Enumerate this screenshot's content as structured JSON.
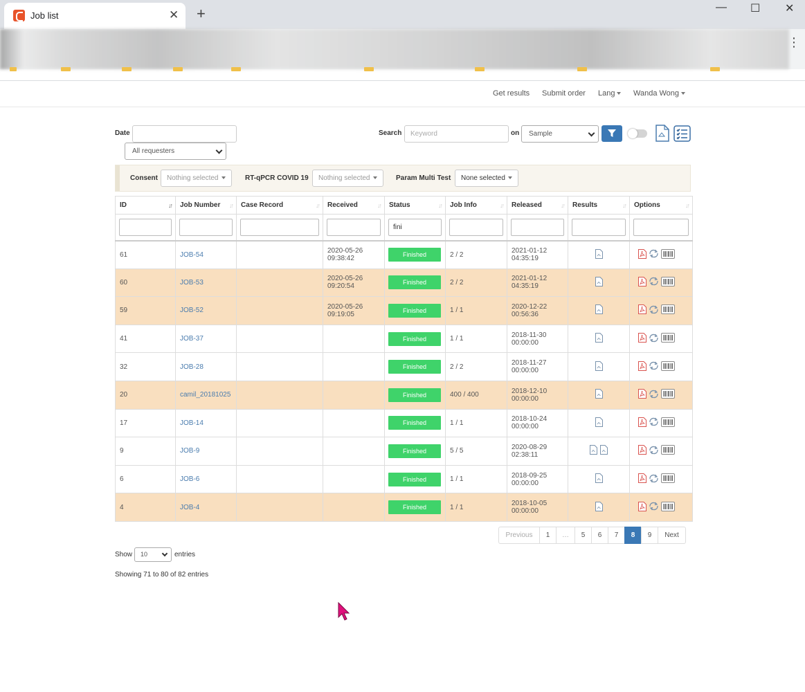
{
  "browser": {
    "tab_title": "Job list",
    "close_glyph": "✕",
    "new_tab_glyph": "+",
    "minimize_glyph": "—",
    "maximize_glyph": "☐",
    "window_close_glyph": "✕",
    "menu_glyph": "⋮"
  },
  "nav": {
    "get_results": "Get results",
    "submit_order": "Submit order",
    "lang": "Lang",
    "user": "Wanda Wong"
  },
  "filters": {
    "date_label": "Date",
    "requesters_value": "All requesters",
    "search_label": "Search",
    "search_placeholder": "Keyword",
    "on_label": "on",
    "on_value": "Sample"
  },
  "multiselects": {
    "consent_label": "Consent",
    "consent_value": "Nothing selected",
    "covid_label": "RT-qPCR COVID 19",
    "covid_value": "Nothing selected",
    "param_label": "Param Multi Test",
    "param_value": "None selected"
  },
  "table": {
    "headers": {
      "id": "ID",
      "job_number": "Job Number",
      "case_record": "Case Record",
      "received": "Received",
      "status": "Status",
      "job_info": "Job Info",
      "released": "Released",
      "results": "Results",
      "options": "Options"
    },
    "status_filter_value": "fini",
    "rows": [
      {
        "id": "61",
        "job": "JOB-54",
        "case": "",
        "received_date": "2020-05-26",
        "received_time": "09:38:42",
        "status": "Finished",
        "info": "2 / 2",
        "released_date": "2021-01-12",
        "released_time": "04:35:19",
        "results": 1,
        "highlight": false
      },
      {
        "id": "60",
        "job": "JOB-53",
        "case": "",
        "received_date": "2020-05-26",
        "received_time": "09:20:54",
        "status": "Finished",
        "info": "2 / 2",
        "released_date": "2021-01-12",
        "released_time": "04:35:19",
        "results": 1,
        "highlight": true
      },
      {
        "id": "59",
        "job": "JOB-52",
        "case": "",
        "received_date": "2020-05-26",
        "received_time": "09:19:05",
        "status": "Finished",
        "info": "1 / 1",
        "released_date": "2020-12-22",
        "released_time": "00:56:36",
        "results": 1,
        "highlight": true
      },
      {
        "id": "41",
        "job": "JOB-37",
        "case": "",
        "received_date": "",
        "received_time": "",
        "status": "Finished",
        "info": "1 / 1",
        "released_date": "2018-11-30",
        "released_time": "00:00:00",
        "results": 1,
        "highlight": false
      },
      {
        "id": "32",
        "job": "JOB-28",
        "case": "",
        "received_date": "",
        "received_time": "",
        "status": "Finished",
        "info": "2 / 2",
        "released_date": "2018-11-27",
        "released_time": "00:00:00",
        "results": 1,
        "highlight": false
      },
      {
        "id": "20",
        "job": "camil_20181025",
        "case": "",
        "received_date": "",
        "received_time": "",
        "status": "Finished",
        "info": "400 / 400",
        "released_date": "2018-12-10",
        "released_time": "00:00:00",
        "results": 1,
        "highlight": true
      },
      {
        "id": "17",
        "job": "JOB-14",
        "case": "",
        "received_date": "",
        "received_time": "",
        "status": "Finished",
        "info": "1 / 1",
        "released_date": "2018-10-24",
        "released_time": "00:00:00",
        "results": 1,
        "highlight": false
      },
      {
        "id": "9",
        "job": "JOB-9",
        "case": "",
        "received_date": "",
        "received_time": "",
        "status": "Finished",
        "info": "5 / 5",
        "released_date": "2020-08-29",
        "released_time": "02:38:11",
        "results": 2,
        "highlight": false
      },
      {
        "id": "6",
        "job": "JOB-6",
        "case": "",
        "received_date": "",
        "received_time": "",
        "status": "Finished",
        "info": "1 / 1",
        "released_date": "2018-09-25",
        "released_time": "00:00:00",
        "results": 1,
        "highlight": false
      },
      {
        "id": "4",
        "job": "JOB-4",
        "case": "",
        "received_date": "",
        "received_time": "",
        "status": "Finished",
        "info": "1 / 1",
        "released_date": "2018-10-05",
        "released_time": "00:00:00",
        "results": 1,
        "highlight": true
      }
    ]
  },
  "pagination": {
    "previous": "Previous",
    "pages": [
      "1",
      "…",
      "5",
      "6",
      "7",
      "8",
      "9"
    ],
    "active": "8",
    "next": "Next"
  },
  "footer": {
    "show_label": "Show",
    "length_value": "10",
    "entries_label": "entries",
    "info": "Showing 71 to 80 of 82 entries"
  },
  "colors": {
    "accent": "#3a78b5",
    "status_finished": "#3fd36a",
    "row_highlight": "#f9dfbf",
    "link": "#4a7cae"
  }
}
